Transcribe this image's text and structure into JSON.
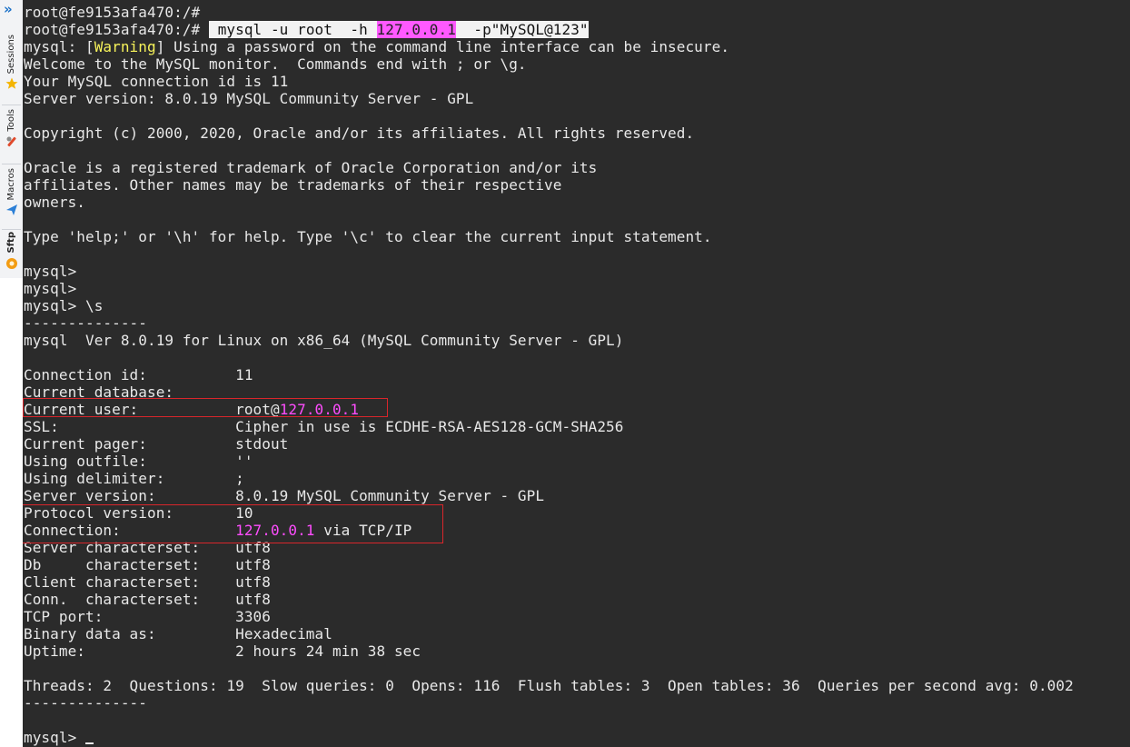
{
  "sidebar": {
    "tabs": [
      {
        "label": "Sessions",
        "icon": "star-icon",
        "color": "#f4b400"
      },
      {
        "label": "Tools",
        "icon": "tools-icon",
        "color": "#e04a2c"
      },
      {
        "label": "Macros",
        "icon": "paper-plane-icon",
        "color": "#2b7fd6"
      },
      {
        "label": "Sftp",
        "icon": "sftp-icon",
        "color": "#f39c12"
      }
    ]
  },
  "terminal": {
    "prompt_root": "root@fe9153afa470:/#",
    "command_parts": {
      "pre": " mysql -u root  -h ",
      "ip": "127.0.0.1",
      "post": "  -p\"MySQL@123\""
    },
    "warning": {
      "pre": "mysql: [",
      "word": "Warning",
      "post": "] Using a password on the command line interface can be insecure."
    },
    "welcome_lines": [
      "Welcome to the MySQL monitor.  Commands end with ; or \\g.",
      "Your MySQL connection id is 11",
      "Server version: 8.0.19 MySQL Community Server - GPL",
      "",
      "Copyright (c) 2000, 2020, Oracle and/or its affiliates. All rights reserved.",
      "",
      "Oracle is a registered trademark of Oracle Corporation and/or its",
      "affiliates. Other names may be trademarks of their respective",
      "owners.",
      "",
      "Type 'help;' or '\\h' for help. Type '\\c' to clear the current input statement.",
      "",
      "mysql>",
      "mysql>",
      "mysql> \\s",
      "--------------",
      "mysql  Ver 8.0.19 for Linux on x86_64 (MySQL Community Server - GPL)",
      "",
      "Connection id:          11",
      "Current database:"
    ],
    "current_user": {
      "label": "Current user:           ",
      "pre": "root@",
      "ip": "127.0.0.1"
    },
    "status_mid_lines": [
      "SSL:                    Cipher in use is ECDHE-RSA-AES128-GCM-SHA256",
      "Current pager:          stdout",
      "Using outfile:          ''",
      "Using delimiter:        ;",
      "Server version:         8.0.19 MySQL Community Server - GPL",
      "Protocol version:       10"
    ],
    "connection": {
      "label": "Connection:             ",
      "ip": "127.0.0.1",
      "post": " via TCP/IP"
    },
    "status_tail_lines": [
      "Server characterset:    utf8",
      "Db     characterset:    utf8",
      "Client characterset:    utf8",
      "Conn.  characterset:    utf8",
      "TCP port:               3306",
      "Binary data as:         Hexadecimal",
      "Uptime:                 2 hours 24 min 38 sec",
      "",
      "Threads: 2  Questions: 19  Slow queries: 0  Opens: 116  Flush tables: 3  Open tables: 36  Queries per second avg: 0.002",
      "--------------",
      ""
    ],
    "final_prompt": "mysql> "
  }
}
